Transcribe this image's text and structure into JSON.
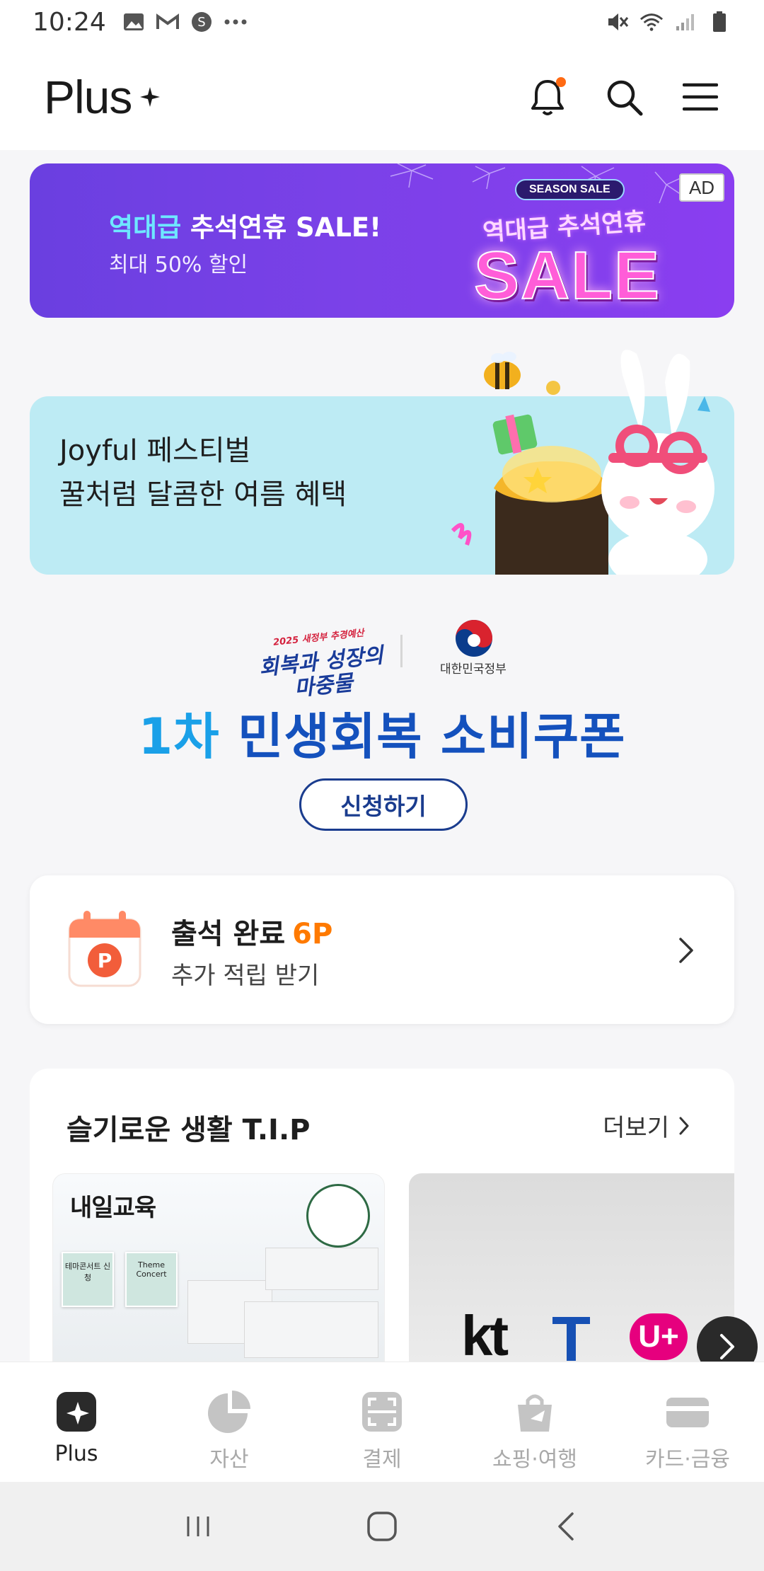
{
  "status_bar": {
    "time": "10:24",
    "left_icons": [
      "image-icon",
      "gmail-icon",
      "s-app-icon",
      "more-dots-icon"
    ],
    "right_icons": [
      "mute-icon",
      "wifi-icon",
      "signal-icon",
      "battery-icon"
    ]
  },
  "header": {
    "brand": "Plus",
    "actions": [
      "notification-bell-icon",
      "search-icon",
      "menu-icon"
    ],
    "has_notification": true
  },
  "ad_banner": {
    "title_highlight": "역대급",
    "title_rest": " 추석연휴 SALE!",
    "subtitle": "최대 50% 할인",
    "tag": "AD",
    "season_label": "SEASON SALE",
    "art_small": "역대급 추석연휴",
    "art_big": "SALE"
  },
  "joy_banner": {
    "line1": "Joyful 페스티벌",
    "line2": "꿀처럼 달콤한 여름 혜택"
  },
  "coupon": {
    "campaign_small": "2025 새정부 추경예산",
    "campaign_line1": "회복과 성장의",
    "campaign_line2": "마중물",
    "gov_name": "대한민국정부",
    "title_num": "1차",
    "title_rest": " 민생회복 소비쿠폰",
    "button": "신청하기"
  },
  "attendance": {
    "title": "출석 완료",
    "points": "6P",
    "subtitle": "추가 적립 받기",
    "icon_letter": "P"
  },
  "tips": {
    "title": "슬기로운 생활 T.I.P",
    "more": "더보기",
    "card1": {
      "brand": "내일교육",
      "poster1": "테마콘서트 신청",
      "poster2": "Theme Concert"
    },
    "card2": {
      "kt": "kt",
      "t": "T",
      "u": "U+"
    }
  },
  "bottom_nav": [
    {
      "label": "Plus",
      "icon": "plus-sparkle-icon",
      "active": true
    },
    {
      "label": "자산",
      "icon": "pie-chart-icon",
      "active": false
    },
    {
      "label": "결제",
      "icon": "scan-icon",
      "active": false
    },
    {
      "label": "쇼핑·여행",
      "icon": "shopping-bag-icon",
      "active": false
    },
    {
      "label": "카드·금융",
      "icon": "card-icon",
      "active": false
    }
  ],
  "colors": {
    "accent_orange": "#ff7a00",
    "coupon_blue": "#1451bd",
    "ad_purple": "#7b41e8",
    "joy_bg": "#bdebf4"
  }
}
